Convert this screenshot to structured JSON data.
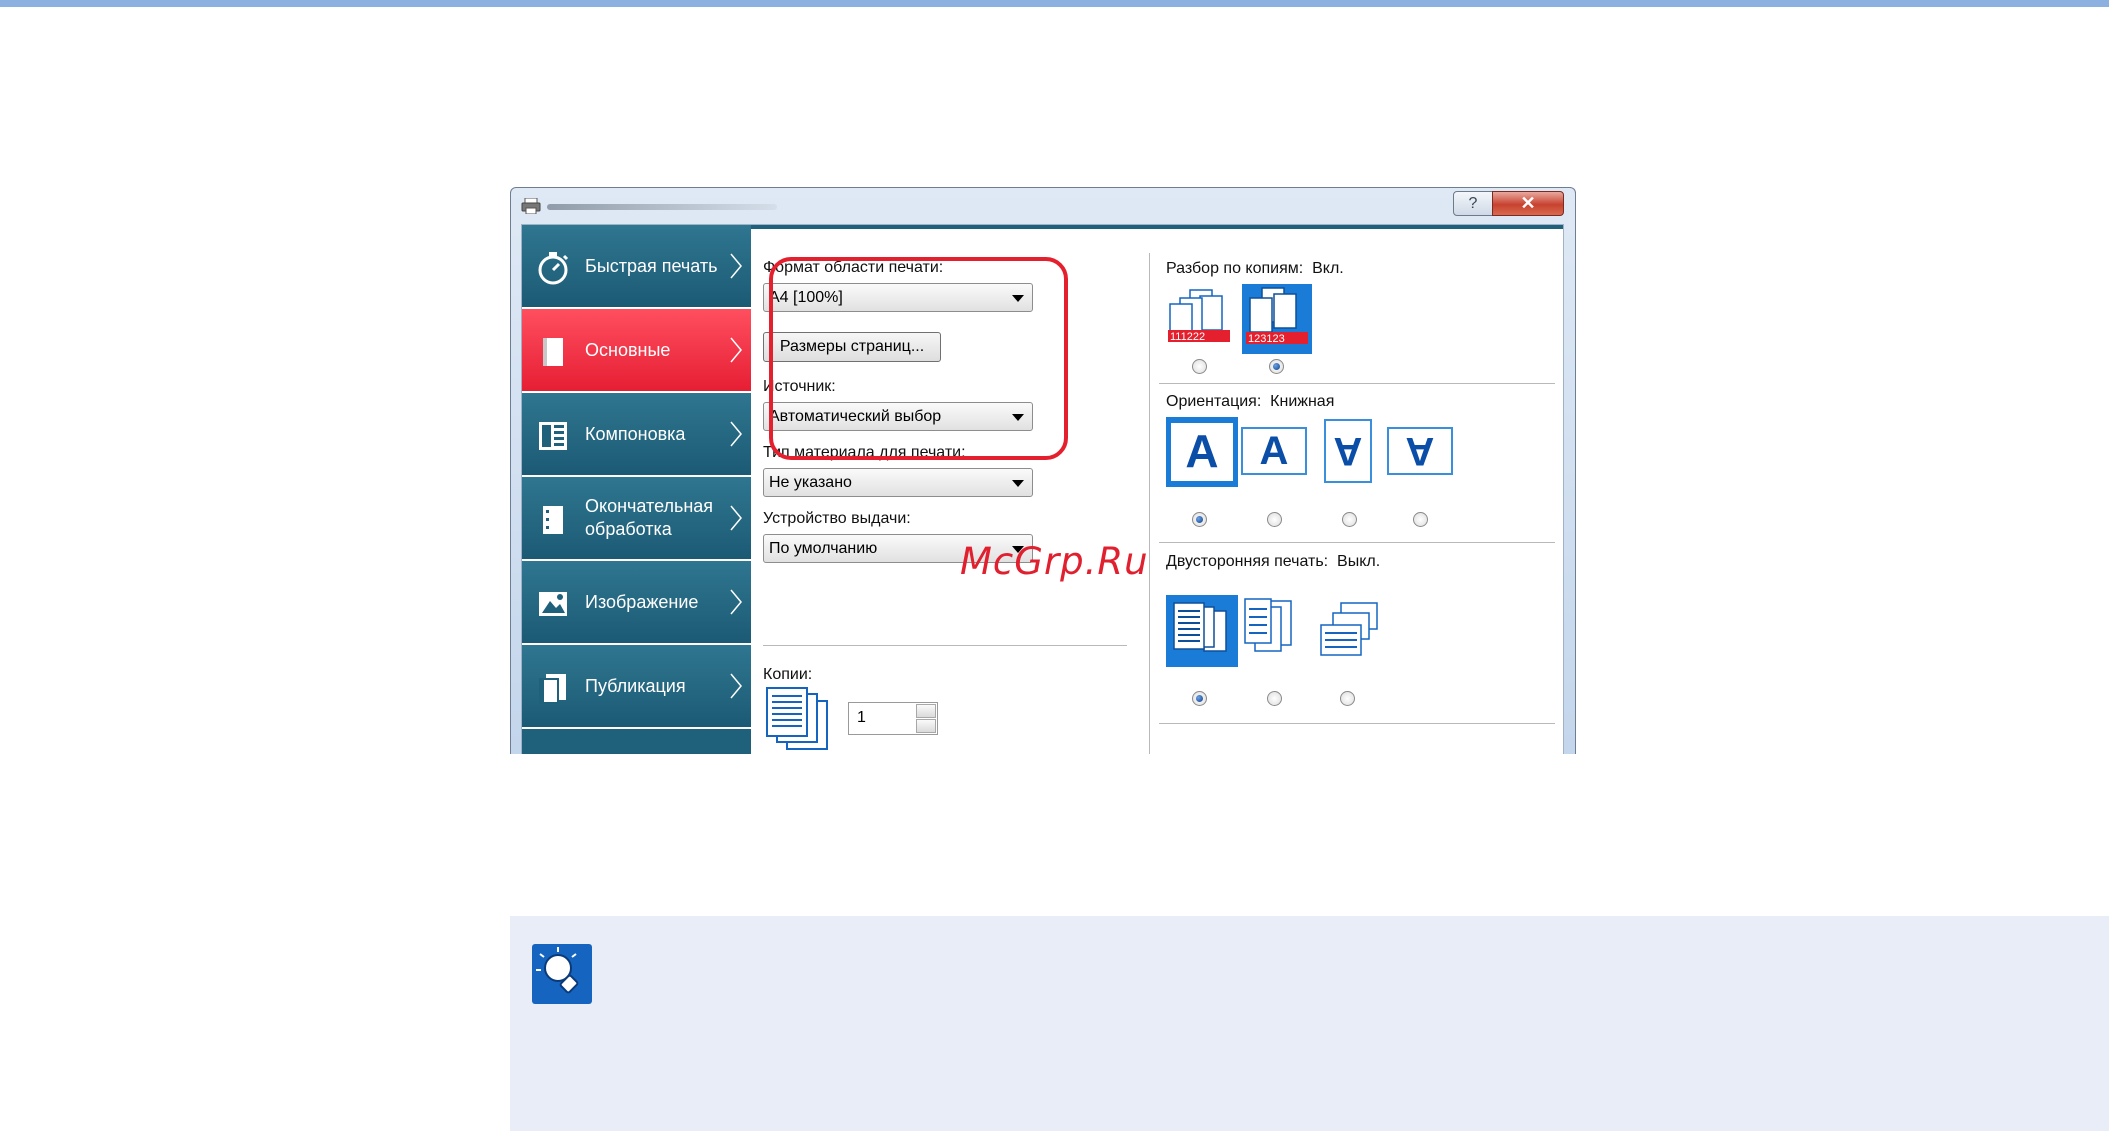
{
  "window": {
    "help_label": "?",
    "close_label": "✕"
  },
  "sidebar": {
    "items": [
      {
        "label": "Быстрая печать",
        "icon": "stopwatch-icon"
      },
      {
        "label": "Основные",
        "icon": "page-icon",
        "active": true
      },
      {
        "label": "Компоновка",
        "icon": "layout-icon"
      },
      {
        "label": "Окончательная обработка",
        "icon": "finishing-icon"
      },
      {
        "label": "Изображение",
        "icon": "image-icon"
      },
      {
        "label": "Публикация",
        "icon": "publication-icon"
      }
    ]
  },
  "main": {
    "print_size_label": "Формат области печати:",
    "print_size_value": "A4  [100%]",
    "page_sizes_button": "Размеры страниц...",
    "source_label": "Источник:",
    "source_value": "Автоматический выбор",
    "media_type_label": "Тип материала для печати:",
    "media_type_value": "Не указано",
    "output_label": "Устройство выдачи:",
    "output_value": "По умолчанию",
    "copies_label": "Копии:",
    "copies_value": "1",
    "collate_label": "Разбор по копиям:",
    "collate_value": "Вкл.",
    "collate_off_text": "111222",
    "collate_on_text": "123123",
    "orientation_label": "Ориентация:",
    "orientation_value": "Книжная",
    "orientation_glyph": "A",
    "duplex_label": "Двусторонняя печать:",
    "duplex_value": "Выкл."
  },
  "watermark": "McGrp.Ru",
  "colors": {
    "sidebar": "#1f607a",
    "active": "#e61e34",
    "highlight": "#e5202e",
    "note_bg": "#e8edf8"
  }
}
